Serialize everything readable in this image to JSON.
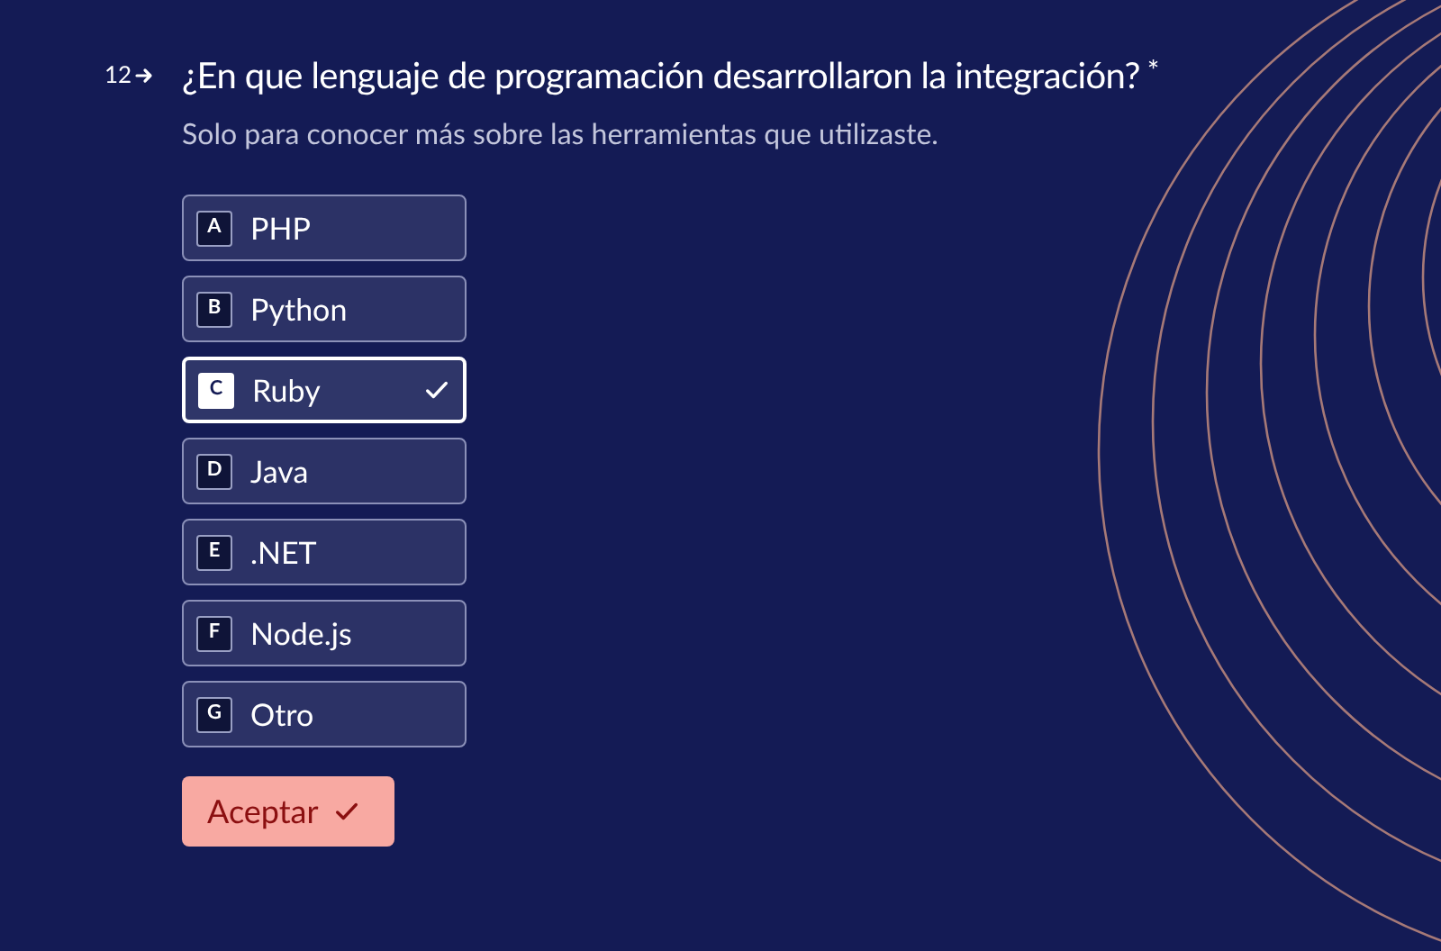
{
  "question": {
    "number": "12",
    "title": "¿En que lenguaje de programación desarrollaron la integración?",
    "required_mark": "*",
    "description": "Solo para conocer más sobre las herramientas que utilizaste."
  },
  "options": [
    {
      "key": "A",
      "label": "PHP",
      "selected": false
    },
    {
      "key": "B",
      "label": "Python",
      "selected": false
    },
    {
      "key": "C",
      "label": "Ruby",
      "selected": true
    },
    {
      "key": "D",
      "label": "Java",
      "selected": false
    },
    {
      "key": "E",
      "label": ".NET",
      "selected": false
    },
    {
      "key": "F",
      "label": "Node.js",
      "selected": false
    },
    {
      "key": "G",
      "label": "Otro",
      "selected": false
    }
  ],
  "submit": {
    "label": "Aceptar"
  }
}
